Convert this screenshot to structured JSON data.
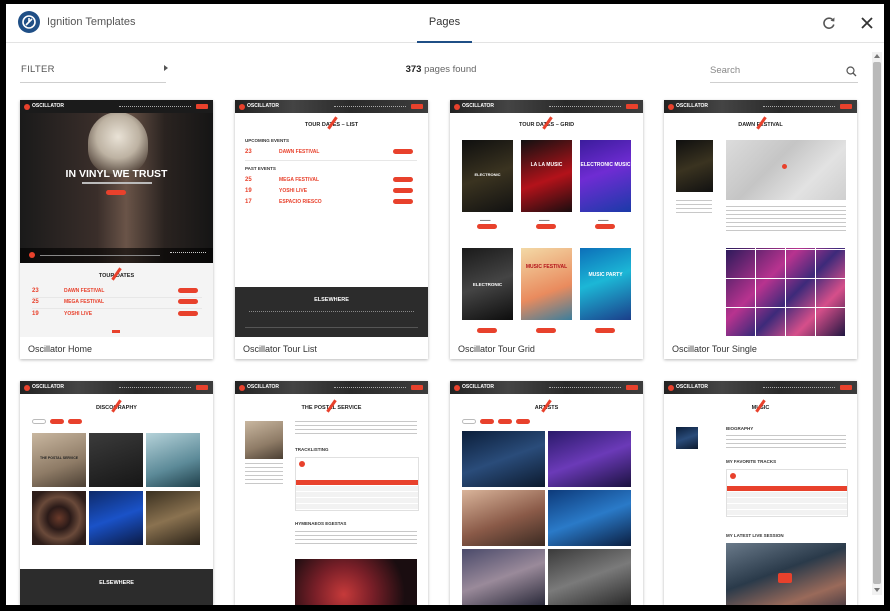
{
  "app": {
    "title": "Ignition Templates",
    "tab": "Pages"
  },
  "filter": {
    "label": "FILTER"
  },
  "results": {
    "count": "373",
    "suffix": "pages found"
  },
  "search": {
    "placeholder": "Search",
    "value": ""
  },
  "colors": {
    "accent": "#e8412c",
    "brand": "#1f4f86",
    "dark": "#1b1b1b"
  },
  "icons": {
    "logo": "ignition-logo-icon",
    "refresh": "refresh-icon",
    "close": "close-icon",
    "search": "search-icon",
    "filter": "caret-right-icon"
  },
  "preview": {
    "brand": "OSCILLATOR",
    "hero_headline": "IN VINYL WE TRUST",
    "tour_dates": "TOUR DATES",
    "tour_dates_list": "TOUR DATES – LIST",
    "tour_dates_grid": "TOUR DATES – GRID",
    "upcoming_events": "UPCOMING EVENTS",
    "past_events": "PAST EVENTS",
    "events": [
      {
        "day": "23",
        "name": "DAWN FESTIVAL"
      },
      {
        "day": "25",
        "name": "MEGA FESTIVAL"
      },
      {
        "day": "19",
        "name": "YOSHI LIVE"
      },
      {
        "day": "17",
        "name": "ESPACIO RIESCO"
      }
    ],
    "footer_brand": "ELSEWHERE",
    "grid_posters": [
      "ELECTRONIC",
      "LA LA MUSIC",
      "ELECTRONIC MUSIC",
      "ELECTRONIC",
      "MUSIC FESTIVAL",
      "MUSIC PARTY"
    ],
    "dawn_festival": "DAWN FESTIVAL",
    "discography": "DISCOGRAPHY",
    "postal_service": "THE POSTAL SERVICE",
    "tracklisting": "TRACKLISTING",
    "hymenaeos": "HYMENAEOS EGESTAS",
    "artists": "ARTISTS",
    "music": "MUSIC",
    "biography": "BIOGRAPHY",
    "favorite_tracks": "MY FAVORITE TRACKS",
    "live_session": "MY LATEST LIVE SESSION"
  },
  "cards": [
    {
      "label": "Oscillator Home"
    },
    {
      "label": "Oscillator Tour List"
    },
    {
      "label": "Oscillator Tour Grid"
    },
    {
      "label": "Oscillator Tour Single"
    },
    {
      "label": ""
    },
    {
      "label": ""
    },
    {
      "label": ""
    },
    {
      "label": ""
    }
  ]
}
